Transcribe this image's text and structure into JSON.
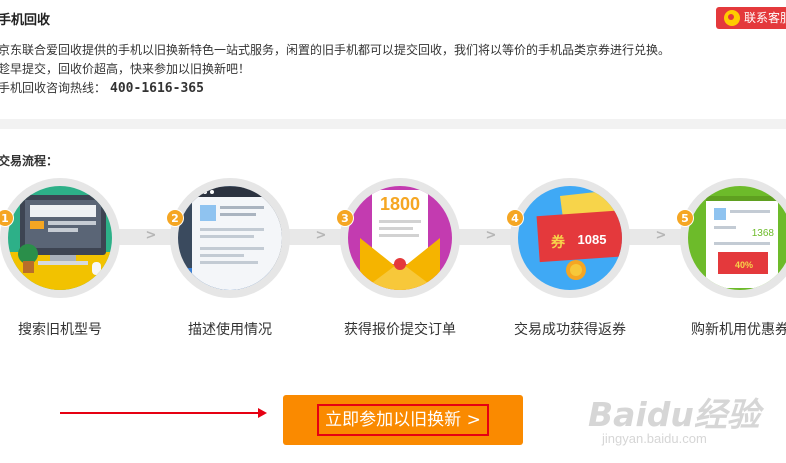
{
  "header": {
    "title": "手机回收",
    "service_button": "联系客服"
  },
  "intro": {
    "line1": "京东联合爱回收提供的手机以旧换新特色一站式服务，闲置的旧手机都可以提交回收，我们将以等价的手机品类京券进行兑换。",
    "line2": "趁早提交，回收价超高，快来参加以旧换新吧！",
    "hotline_label": "手机回收咨询热线：",
    "hotline_number": "400-1616-365"
  },
  "flow": {
    "title": "交易流程：",
    "steps": [
      {
        "num": "1",
        "label": "搜索旧机型号",
        "icon": "monitor-icon",
        "color": "#2db088"
      },
      {
        "num": "2",
        "label": "描述使用情况",
        "icon": "browser-form-icon",
        "color": "#3a4a5e"
      },
      {
        "num": "3",
        "label": "获得报价提交订单",
        "icon": "envelope-quote-icon",
        "color": "#c33bb0",
        "quote_text": "1800"
      },
      {
        "num": "4",
        "label": "交易成功获得返券",
        "icon": "coupon-icon",
        "color": "#3fa9f5",
        "coupon_char": "券",
        "coupon_value": "1085"
      },
      {
        "num": "5",
        "label": "购新机用优惠券",
        "icon": "receipt-icon",
        "color": "#6dbb2a",
        "receipt_value": "1368",
        "receipt_discount": "40%"
      }
    ]
  },
  "cta": {
    "label": "立即参加以旧换新 >"
  },
  "watermark": {
    "main": "Baidu经验",
    "sub": "jingyan.baidu.com"
  },
  "colors": {
    "cta_bg": "#fa8a00",
    "cta_border": "#e60012",
    "step_badge": "#f5a623",
    "service_btn": "#e4393c"
  }
}
